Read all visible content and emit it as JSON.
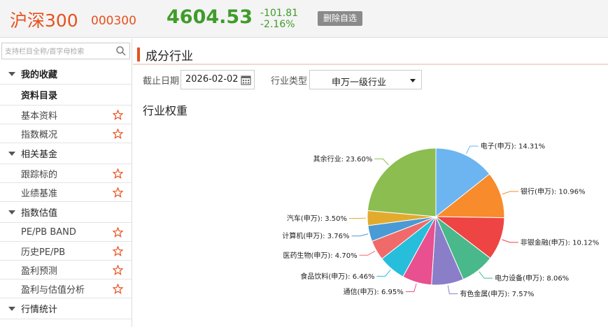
{
  "header": {
    "index_name": "沪深300",
    "index_code": "000300",
    "price": "4604.53",
    "change": "-101.81",
    "change_pct": "-2.16%",
    "remove_button": "删除自选",
    "color_down": "#3f9c2a",
    "color_accent": "#e8501e"
  },
  "sidebar": {
    "search_placeholder": "支持栏目全称/首字母检索",
    "groups": [
      {
        "label": "我的收藏",
        "bold": true,
        "items": [
          {
            "label": "资料目录",
            "section": true,
            "star": false
          },
          {
            "label": "基本资料",
            "star": true
          },
          {
            "label": "指数概况",
            "star": true
          }
        ]
      },
      {
        "label": "相关基金",
        "items": [
          {
            "label": "跟踪标的",
            "star": true
          },
          {
            "label": "业绩基准",
            "star": true
          }
        ]
      },
      {
        "label": "指数估值",
        "items": [
          {
            "label": "PE/PB BAND",
            "star": true
          },
          {
            "label": "历史PE/PB",
            "star": true
          },
          {
            "label": "盈利预测",
            "star": true
          },
          {
            "label": "盈利与估值分析",
            "star": true
          }
        ]
      },
      {
        "label": "行情统计",
        "items": []
      }
    ]
  },
  "main": {
    "section_title": "成分行业",
    "date_label": "截止日期",
    "date_value": "2026-02-02",
    "type_label": "行业类型",
    "type_value": "申万一级行业",
    "chart_heading": "行业权重"
  },
  "chart_data": {
    "type": "pie",
    "title": "",
    "slices": [
      {
        "label": "电子(申万): 14.31%",
        "value": 14.31,
        "color": "#6cb5f0"
      },
      {
        "label": "银行(申万): 10.96%",
        "value": 10.96,
        "color": "#f88b2b"
      },
      {
        "label": "非银金融(申万): 10.12%",
        "value": 10.12,
        "color": "#ef4444"
      },
      {
        "label": "电力设备(申万): 8.06%",
        "value": 8.06,
        "color": "#49b88a"
      },
      {
        "label": "有色金属(申万): 7.57%",
        "value": 7.57,
        "color": "#8a7ec9"
      },
      {
        "label": "通信(申万): 6.95%",
        "value": 6.95,
        "color": "#e8508f"
      },
      {
        "label": "食品饮料(申万): 6.46%",
        "value": 6.46,
        "color": "#26bedb"
      },
      {
        "label": "医药生物(申万): 4.70%",
        "value": 4.7,
        "color": "#f06a6a"
      },
      {
        "label": "计算机(申万): 3.76%",
        "value": 3.76,
        "color": "#4a9ad6"
      },
      {
        "label": "汽车(申万): 3.50%",
        "value": 3.5,
        "color": "#e3ab2e"
      },
      {
        "label": "其余行业: 23.60%",
        "value": 23.6,
        "color": "#8cbd50"
      }
    ]
  }
}
